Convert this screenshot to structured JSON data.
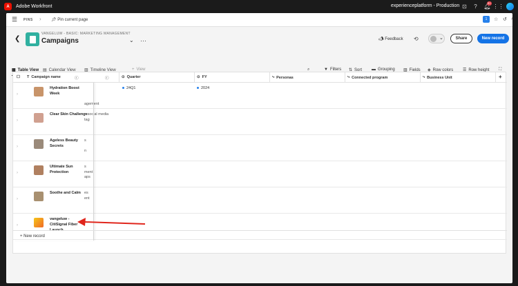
{
  "topbar": {
    "app_name": "Adobe Workfront",
    "environment": "experienceplatform - Production",
    "notification_count": "9+"
  },
  "pinsbar": {
    "pins_label": "PINS",
    "pin_current": "Pin current page",
    "counter": "1"
  },
  "header": {
    "breadcrumb": "VANGELUW - BASIC: MARKETING MANAGEMENT",
    "title": "Campaigns",
    "feedback": "Feedback",
    "share": "Share",
    "new_record": "New record"
  },
  "views": {
    "table": "Table View",
    "calendar": "Calendar View",
    "timeline": "Timeline View",
    "add": "View"
  },
  "toolbar": {
    "filters": "Filters",
    "sort": "Sort",
    "grouping": "Grouping",
    "fields": "Fields",
    "row_colors": "Row colors",
    "row_height": "Row height"
  },
  "columns": {
    "campaign_name": "Campaign name",
    "quarter": "Quarter",
    "fy": "FY",
    "personas": "Personas",
    "connected_program": "Connected program",
    "business_unit": "Business Unit"
  },
  "rows": [
    {
      "name": "Hydration Boost Week",
      "behind": [
        "",
        "agement"
      ],
      "quarter": "24Q1",
      "fy": "2024",
      "thumb": "#c8946a"
    },
    {
      "name": "Clear Skin Challenge",
      "behind": [
        "n social media",
        "tag"
      ],
      "quarter": "",
      "fy": "",
      "thumb": "#d0a090"
    },
    {
      "name": "Ageless Beauty Secrets",
      "behind": [
        "s",
        "",
        "n"
      ],
      "quarter": "",
      "fy": "",
      "thumb": "#9a8a7a"
    },
    {
      "name": "Ultimate Sun Protection",
      "behind": [
        "s",
        "ment",
        "aps"
      ],
      "quarter": "",
      "fy": "",
      "thumb": "#b08060"
    },
    {
      "name": "Soothe and Calm",
      "behind": [
        "es",
        "ent"
      ],
      "quarter": "",
      "fy": "",
      "thumb": "#a89070"
    },
    {
      "name": "vangeluw - CitiSignal Fiber Launch",
      "behind": [],
      "quarter": "",
      "fy": "",
      "thumb": "#f0b020"
    }
  ],
  "new_record_row": "New record",
  "colors": {
    "accent": "#1473e6",
    "annotation_arrow": "#e0251b"
  }
}
